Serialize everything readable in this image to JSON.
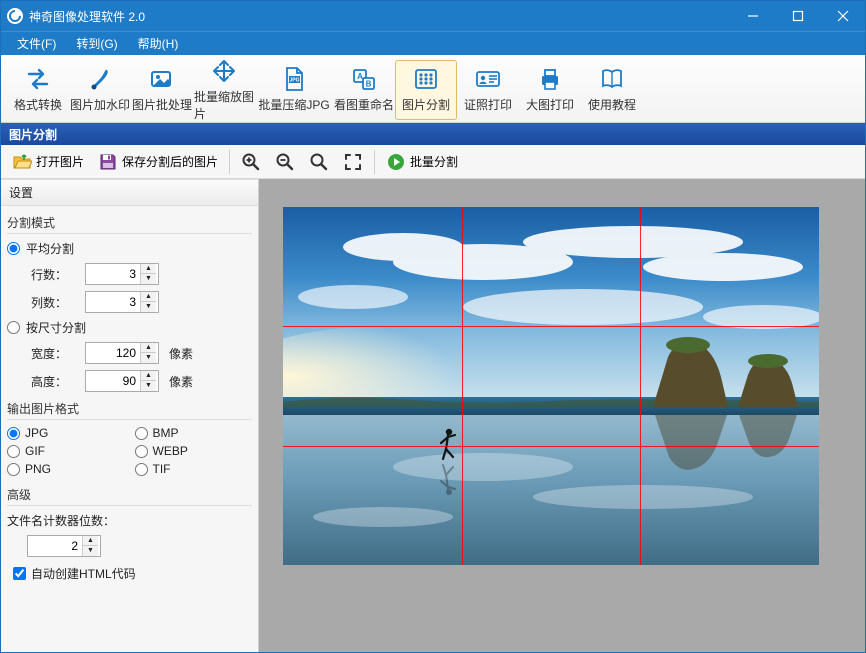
{
  "titlebar": {
    "title": "神奇图像处理软件 2.0"
  },
  "menubar": {
    "file": "文件(F)",
    "goto": "转到(G)",
    "help": "帮助(H)"
  },
  "toolbar": {
    "format_convert": "格式转换",
    "watermark": "图片加水印",
    "batch_process": "图片批处理",
    "batch_resize": "批量缩放图片",
    "batch_compress_jpg": "批量压缩JPG",
    "rename_by_view": "看图重命名",
    "split_image": "图片分割",
    "id_photo": "证照打印",
    "big_print": "大图打印",
    "tutorial": "使用教程"
  },
  "section_header": "图片分割",
  "subtoolbar": {
    "open_image": "打开图片",
    "save_split": "保存分割后的图片",
    "batch_split": "批量分割"
  },
  "sidebar": {
    "settings_header": "设置",
    "split_mode": {
      "legend": "分割模式",
      "avg_split": "平均分割",
      "rows_label": "行数：",
      "rows_value": "3",
      "cols_label": "列数：",
      "cols_value": "3",
      "by_size": "按尺寸分割",
      "width_label": "宽度：",
      "width_value": "120",
      "height_label": "高度：",
      "height_value": "90",
      "unit": "像素"
    },
    "output_format": {
      "legend": "输出图片格式",
      "jpg": "JPG",
      "bmp": "BMP",
      "gif": "GIF",
      "webp": "WEBP",
      "png": "PNG",
      "tif": "TIF"
    },
    "advanced": {
      "legend": "高级",
      "counter_digits_label": "文件名计数器位数：",
      "counter_digits_value": "2",
      "auto_html": "自动创建HTML代码"
    }
  }
}
